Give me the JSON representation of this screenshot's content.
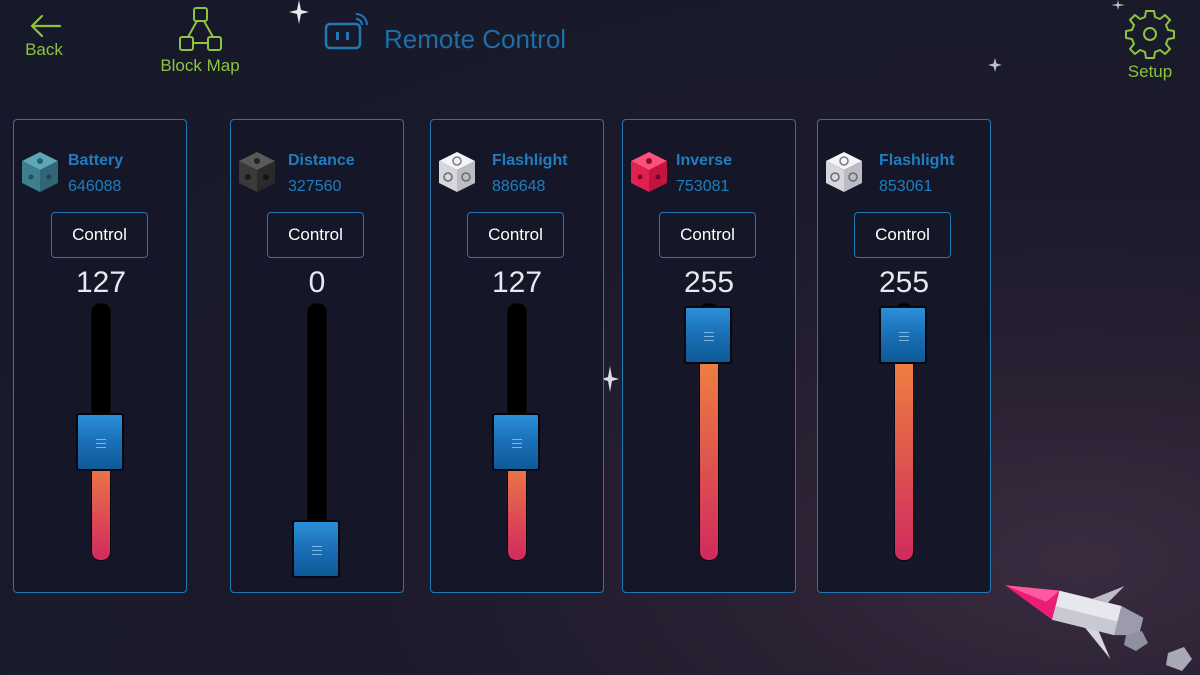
{
  "header": {
    "back_label": "Back",
    "blockmap_label": "Block Map",
    "title": "Remote Control",
    "setup_label": "Setup"
  },
  "colors": {
    "nav_green": "#8dc43f",
    "accent_blue": "#1f79b5",
    "fill_top": "#f08a3c",
    "fill_bottom": "#d12a5e"
  },
  "panels": [
    {
      "name": "Battery",
      "id": "646088",
      "control_label": "Control",
      "value": "127",
      "level": 0.5,
      "cube": "teal"
    },
    {
      "name": "Distance",
      "id": "327560",
      "control_label": "Control",
      "value": "0",
      "level": 0.0,
      "cube": "black"
    },
    {
      "name": "Flashlight",
      "id": "886648",
      "control_label": "Control",
      "value": "127",
      "level": 0.5,
      "cube": "white"
    },
    {
      "name": "Inverse",
      "id": "753081",
      "control_label": "Control",
      "value": "255",
      "level": 1.0,
      "cube": "pink"
    },
    {
      "name": "Flashlight",
      "id": "853061",
      "control_label": "Control",
      "value": "255",
      "level": 1.0,
      "cube": "white"
    }
  ]
}
